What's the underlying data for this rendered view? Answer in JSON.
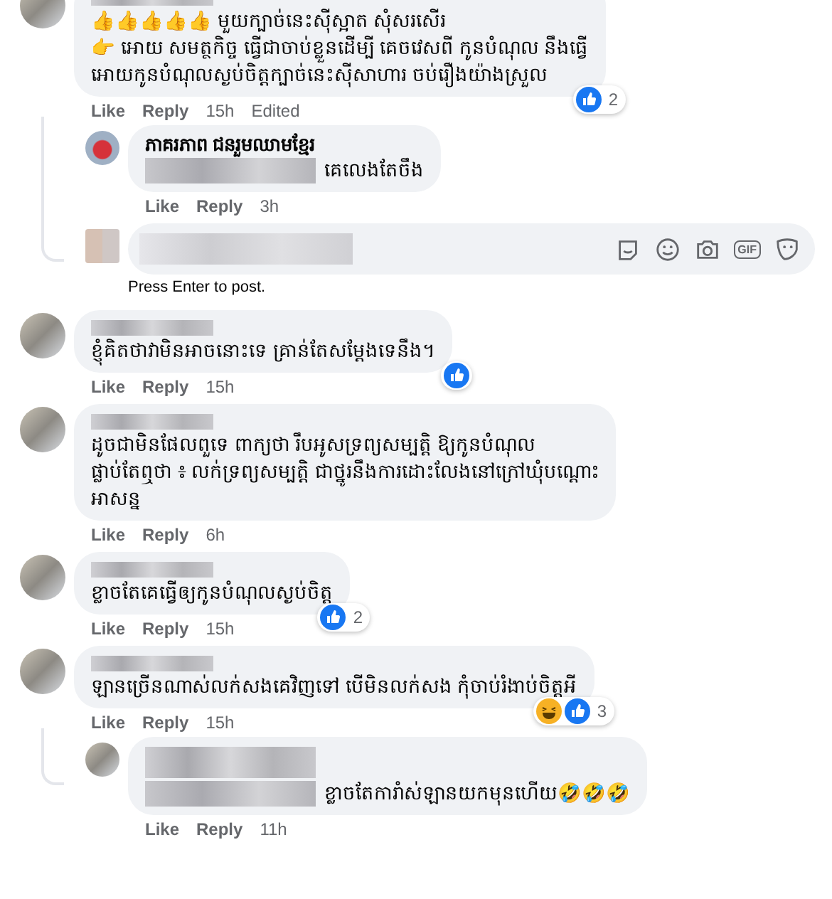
{
  "comments": [
    {
      "text": "👍👍👍👍👍 មួយក្បាច់នេះស៊ីស្អាត សុំសរសើរ\n👉 អោយ សមត្ថកិច្ច ធ្វើជាចាប់ខ្លួនដើម្បី គេចវេសពី កូនបំណុល នឹងធ្វើ\nអោយកូនបំណុលស្ងប់ចិត្តក្បាច់នេះស៊ីសាហារ ចប់រឿងយ៉ាងស្រួល",
      "actions": [
        "Like",
        "Reply"
      ],
      "time": "15h",
      "edited": "Edited",
      "reactions": {
        "icons": [
          {
            "kind": "like"
          }
        ],
        "count": "2"
      },
      "replies": [
        {
          "name": "ភាគរភាព ជនរួមឈាមខ្មែរ",
          "mention": true,
          "text": "គេលេងតែចឹង",
          "actions": [
            "Like",
            "Reply"
          ],
          "time": "3h"
        }
      ],
      "composer": {
        "gif_label": "GIF",
        "hint": "Press Enter to post."
      }
    },
    {
      "text": "ខ្ញុំគិតថាវាមិនអាចនោះទេ គ្រាន់តែសម្តែងទេនឹង។",
      "actions": [
        "Like",
        "Reply"
      ],
      "time": "15h",
      "reactions": {
        "icons": [
          {
            "kind": "like"
          }
        ]
      }
    },
    {
      "text": "ដូចជាមិនផែលពួទេ ពាក្យថា រឹបអូសទ្រព្យសម្បត្តិ ឱ្យកូនបំណុល\nផ្លាប់តែឮថា ៖ លក់ទ្រព្យសម្បត្តិ ជាថ្នូរនឹងការដោះលែងនៅក្រៅឃុំបណ្ដោះ\nអាសន្ន",
      "actions": [
        "Like",
        "Reply"
      ],
      "time": "6h"
    },
    {
      "text": "ខ្លាចតែគេធ្វើឲ្យកូនបំណុលស្ងប់ចិត្ត",
      "actions": [
        "Like",
        "Reply"
      ],
      "time": "15h",
      "reactions": {
        "icons": [
          {
            "kind": "like"
          }
        ],
        "count": "2"
      }
    },
    {
      "text": "ឡានច្រើនណាស់លក់សងគេវិញទៅ បើមិនលក់សង កុំចាប់រំងាប់ចិត្តអី",
      "actions": [
        "Like",
        "Reply"
      ],
      "time": "15h",
      "reactions": {
        "icons": [
          {
            "kind": "haha"
          },
          {
            "kind": "like"
          }
        ],
        "count": "3"
      },
      "replies": [
        {
          "mention": true,
          "text": "ខ្លាចតែការាំស់ឡានយកមុនហើយ🤣🤣🤣",
          "actions": [
            "Like",
            "Reply"
          ],
          "time": "11h"
        }
      ]
    }
  ]
}
